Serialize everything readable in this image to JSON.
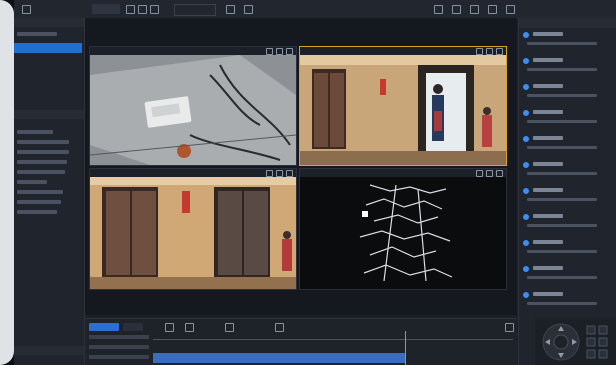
{
  "toolbar": {
    "items": [
      {
        "icon": "home-icon"
      },
      {
        "icon": "layout-icon"
      },
      {
        "icon": "split-icon"
      },
      {
        "icon": "record-icon"
      },
      {
        "icon": "snapshot-icon"
      },
      {
        "icon": "fullscreen-icon"
      },
      {
        "icon": "settings-icon"
      }
    ]
  },
  "left_panel": {
    "device_tree_header": "",
    "group_header": ""
  },
  "panes": [
    {
      "title": ""
    },
    {
      "title": ""
    },
    {
      "title": ""
    },
    {
      "title": ""
    }
  ],
  "playback": {
    "tabs": [
      "",
      ""
    ]
  },
  "events": {
    "header": "",
    "items": [
      "",
      "",
      "",
      "",
      "",
      "",
      "",
      "",
      "",
      "",
      ""
    ]
  },
  "colors": {
    "accent": "#1f6fd1",
    "selected_pane_border": "#d9a520",
    "timeline_track": "#3a6cc0"
  }
}
